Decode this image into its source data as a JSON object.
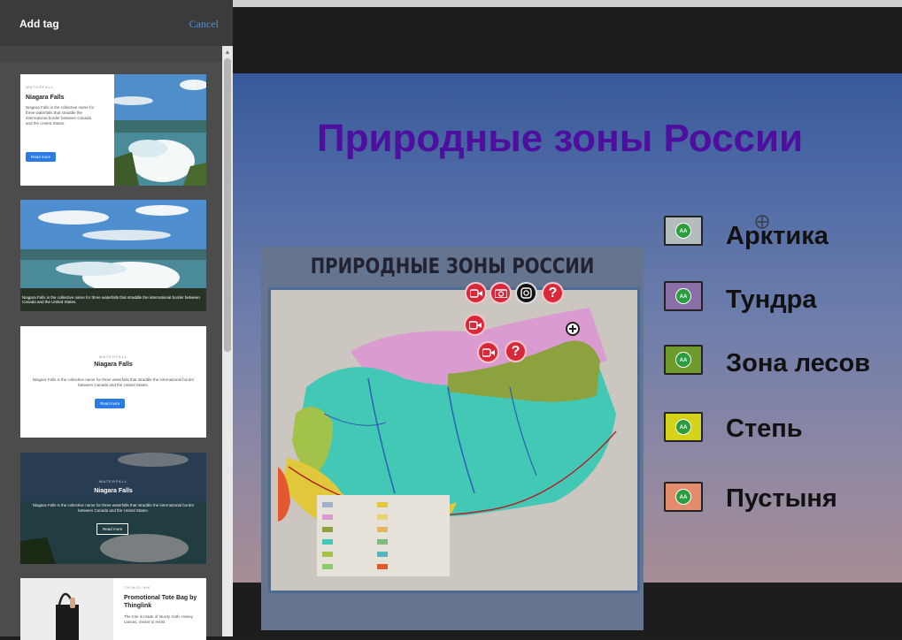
{
  "panel": {
    "title": "Add tag",
    "cancel_label": "Cancel"
  },
  "cards": [
    {
      "kicker": "WATERFALL",
      "title": "Niagara Falls",
      "description": "Niagara Falls is the collective name for three waterfalls that straddle the international border between Canada and the United States.",
      "button": "Read more"
    },
    {
      "caption": "Niagara Falls is the collective name for three waterfalls that straddle the international border between Canada and the United States."
    },
    {
      "kicker": "WATERFALL",
      "title": "Niagara Falls",
      "description": "Niagara Falls is the collective name for three waterfalls that straddle the international border between Canada and the United States.",
      "button": "Read more"
    },
    {
      "kicker": "WATERFALL",
      "title": "Niagara Falls",
      "description": "Niagara Falls is the collective name for three waterfalls that straddle the international border between Canada and the United States.",
      "button": "Read more"
    },
    {
      "kicker": "THINGLINK",
      "title": "Promotional Tote Bag by Thinglink",
      "description": "The tote is made of sturdy cloth. Heavy canvas, meant to resist"
    }
  ],
  "slide": {
    "title": "Природные зоны России",
    "map_heading": "ПРИРОДНЫЕ ЗОНЫ РОССИИ",
    "legend": [
      {
        "label": "Арктика",
        "color": "#b4bcbe"
      },
      {
        "label": "Тундра",
        "color": "#8a6fa6"
      },
      {
        "label": "Зона лесов",
        "color": "#6f9a2c"
      },
      {
        "label": "Степь",
        "color": "#d5d21a"
      },
      {
        "label": "Пустыня",
        "color": "#e48d6c"
      }
    ],
    "hotspots": [
      {
        "name": "video-hotspot-1",
        "icon": "video-camera-icon",
        "color": "#d8283a"
      },
      {
        "name": "camera-hotspot",
        "icon": "camera-icon",
        "color": "#d8283a"
      },
      {
        "name": "instagram-hotspot",
        "icon": "instagram-icon",
        "color": "#111111"
      },
      {
        "name": "question-hotspot-1",
        "icon": "question-icon",
        "color": "#d8283a"
      },
      {
        "name": "video-hotspot-2",
        "icon": "video-camera-icon",
        "color": "#d8283a"
      },
      {
        "name": "video-hotspot-3",
        "icon": "video-camera-icon",
        "color": "#d8283a"
      },
      {
        "name": "question-hotspot-2",
        "icon": "question-icon",
        "color": "#d8283a"
      },
      {
        "name": "add-tag-crosshair",
        "icon": "plus-circle-icon",
        "color": "#ffffff"
      }
    ],
    "legend_badge": "АА",
    "question_mark": "?"
  }
}
